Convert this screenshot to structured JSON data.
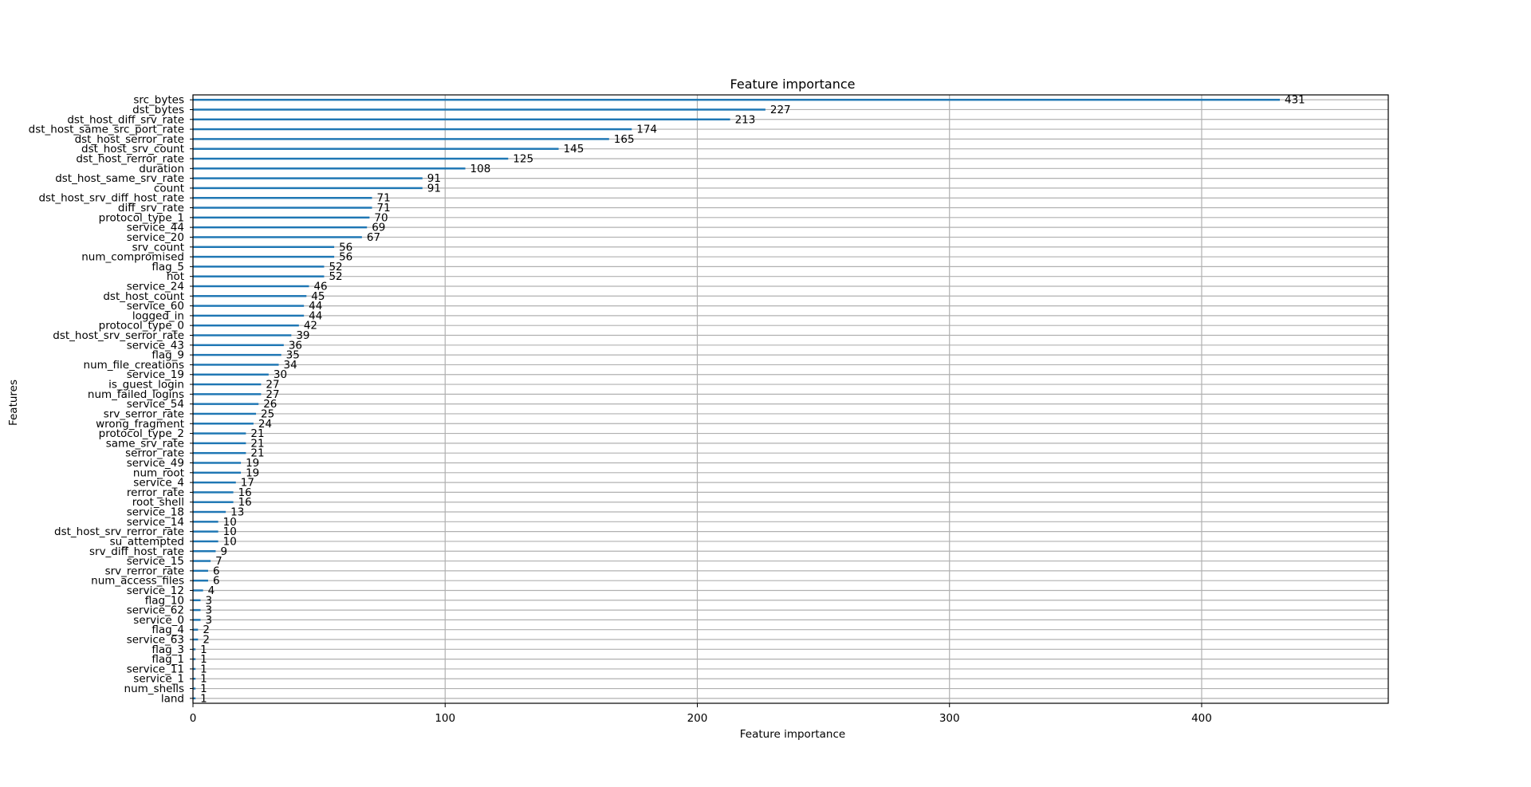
{
  "chart_data": {
    "type": "bar",
    "orientation": "horizontal",
    "title": "Feature importance",
    "xlabel": "Feature importance",
    "ylabel": "Features",
    "xlim": [
      0,
      474
    ],
    "xticks": [
      0,
      100,
      200,
      300,
      400
    ],
    "grid": true,
    "bar_color": "#1f77b4",
    "grid_color": "#b0b0b0",
    "categories": [
      "src_bytes",
      "dst_bytes",
      "dst_host_diff_srv_rate",
      "dst_host_same_src_port_rate",
      "dst_host_serror_rate",
      "dst_host_srv_count",
      "dst_host_rerror_rate",
      "duration",
      "dst_host_same_srv_rate",
      "count",
      "dst_host_srv_diff_host_rate",
      "diff_srv_rate",
      "protocol_type_1",
      "service_44",
      "service_20",
      "srv_count",
      "num_compromised",
      "flag_5",
      "hot",
      "service_24",
      "dst_host_count",
      "service_60",
      "logged_in",
      "protocol_type_0",
      "dst_host_srv_serror_rate",
      "service_43",
      "flag_9",
      "num_file_creations",
      "service_19",
      "is_guest_login",
      "num_failed_logins",
      "service_54",
      "srv_serror_rate",
      "wrong_fragment",
      "protocol_type_2",
      "same_srv_rate",
      "serror_rate",
      "service_49",
      "num_root",
      "service_4",
      "rerror_rate",
      "root_shell",
      "service_18",
      "service_14",
      "dst_host_srv_rerror_rate",
      "su_attempted",
      "srv_diff_host_rate",
      "service_15",
      "srv_rerror_rate",
      "num_access_files",
      "service_12",
      "flag_10",
      "service_62",
      "service_0",
      "flag_4",
      "service_63",
      "flag_3",
      "flag_1",
      "service_11",
      "service_1",
      "num_shells",
      "land"
    ],
    "values": [
      431,
      227,
      213,
      174,
      165,
      145,
      125,
      108,
      91,
      91,
      71,
      71,
      70,
      69,
      67,
      56,
      56,
      52,
      52,
      46,
      45,
      44,
      44,
      42,
      39,
      36,
      35,
      34,
      30,
      27,
      27,
      26,
      25,
      24,
      21,
      21,
      21,
      19,
      19,
      17,
      16,
      16,
      13,
      10,
      10,
      10,
      9,
      7,
      6,
      6,
      4,
      3,
      3,
      3,
      2,
      2,
      1,
      1,
      1,
      1,
      1,
      1
    ]
  }
}
